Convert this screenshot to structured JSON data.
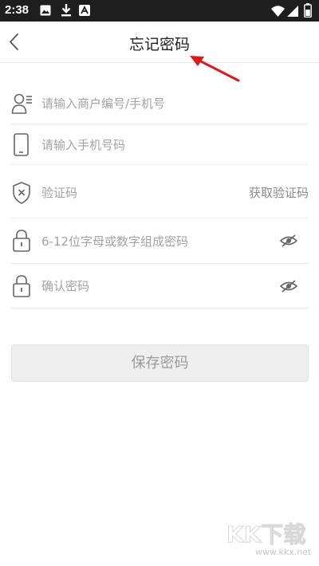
{
  "status_bar": {
    "time": "2:38",
    "left_icons": [
      "image-icon",
      "download-icon",
      "app-icon"
    ],
    "right_icons": [
      "wifi-icon",
      "signal-icon",
      "battery-icon"
    ]
  },
  "header": {
    "title": "忘记密码",
    "back_icon": "chevron-left-icon"
  },
  "form": {
    "merchant": {
      "placeholder": "请输入商户编号/手机号",
      "icon": "user-icon"
    },
    "phone": {
      "placeholder": "请输入手机号码",
      "icon": "phone-icon"
    },
    "code": {
      "placeholder": "验证码",
      "icon": "shield-icon",
      "action_label": "获取验证码"
    },
    "password": {
      "placeholder": "6-12位字母或数字组成密码",
      "icon": "lock-icon",
      "toggle_icon": "eye-off-icon"
    },
    "confirm": {
      "placeholder": "确认密码",
      "icon": "lock-icon",
      "toggle_icon": "eye-off-icon"
    }
  },
  "save_button": {
    "label": "保存密码"
  },
  "watermark": {
    "text": "KK下载",
    "url": "www.kkx.net"
  },
  "colors": {
    "status_bar": "#1e1e1e",
    "annotation_arrow": "#d9191c",
    "button_bg": "#efefef"
  }
}
